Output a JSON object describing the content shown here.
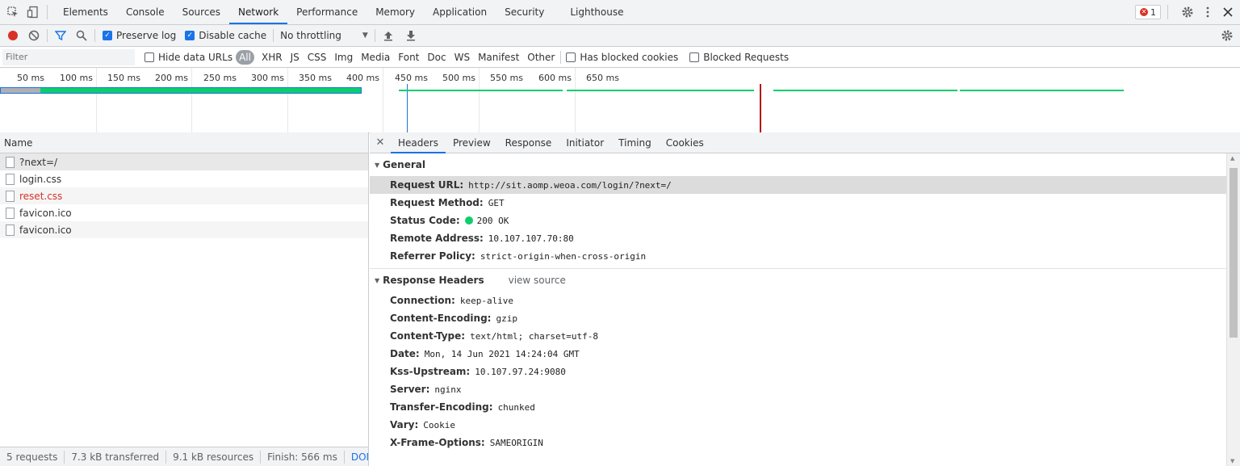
{
  "tabs": {
    "items": [
      "Elements",
      "Console",
      "Sources",
      "Network",
      "Performance",
      "Memory",
      "Application",
      "Security",
      "Lighthouse"
    ],
    "active": "Network",
    "error_count": "1"
  },
  "toolbar": {
    "preserve_log": "Preserve log",
    "disable_cache": "Disable cache",
    "throttling": "No throttling",
    "preserve_log_checked": true,
    "disable_cache_checked": true
  },
  "filter": {
    "placeholder": "Filter",
    "hide_data_urls": "Hide data URLs",
    "types": [
      "All",
      "XHR",
      "JS",
      "CSS",
      "Img",
      "Media",
      "Font",
      "Doc",
      "WS",
      "Manifest",
      "Other"
    ],
    "active_type": "All",
    "has_blocked_cookies": "Has blocked cookies",
    "blocked_requests": "Blocked Requests"
  },
  "overview": {
    "ticks": [
      "50 ms",
      "100 ms",
      "150 ms",
      "200 ms",
      "250 ms",
      "300 ms",
      "350 ms",
      "400 ms",
      "450 ms",
      "500 ms",
      "550 ms",
      "600 ms",
      "650 ms"
    ],
    "colors": {
      "waiting": "#0cce6b",
      "blue": "#1a73e8",
      "dom": "#1a73e8",
      "load": "#b31412"
    }
  },
  "requests": {
    "header": "Name",
    "items": [
      {
        "name": "?next=/",
        "error": false
      },
      {
        "name": "login.css",
        "error": false
      },
      {
        "name": "reset.css",
        "error": true
      },
      {
        "name": "favicon.ico",
        "error": false
      },
      {
        "name": "favicon.ico",
        "error": false
      }
    ]
  },
  "status": {
    "requests": "5 requests",
    "transferred": "7.3 kB transferred",
    "resources": "9.1 kB resources",
    "finish": "Finish: 566 ms",
    "dom": "DOMConte"
  },
  "detail_tabs": [
    "Headers",
    "Preview",
    "Response",
    "Initiator",
    "Timing",
    "Cookies"
  ],
  "general": {
    "title": "General",
    "rows": [
      {
        "k": "Request URL:",
        "v": "http://sit.aomp.weoa.com/login/?next=/"
      },
      {
        "k": "Request Method:",
        "v": "GET"
      },
      {
        "k": "Status Code:",
        "v": "200 OK"
      },
      {
        "k": "Remote Address:",
        "v": "10.107.107.70:80"
      },
      {
        "k": "Referrer Policy:",
        "v": "strict-origin-when-cross-origin"
      }
    ]
  },
  "response_headers": {
    "title": "Response Headers",
    "view_source": "view source",
    "rows": [
      {
        "k": "Connection:",
        "v": "keep-alive"
      },
      {
        "k": "Content-Encoding:",
        "v": "gzip"
      },
      {
        "k": "Content-Type:",
        "v": "text/html; charset=utf-8"
      },
      {
        "k": "Date:",
        "v": "Mon, 14 Jun 2021 14:24:04 GMT"
      },
      {
        "k": "Kss-Upstream:",
        "v": "10.107.97.24:9080"
      },
      {
        "k": "Server:",
        "v": "nginx"
      },
      {
        "k": "Transfer-Encoding:",
        "v": "chunked"
      },
      {
        "k": "Vary:",
        "v": "Cookie"
      },
      {
        "k": "X-Frame-Options:",
        "v": "SAMEORIGIN"
      }
    ]
  }
}
